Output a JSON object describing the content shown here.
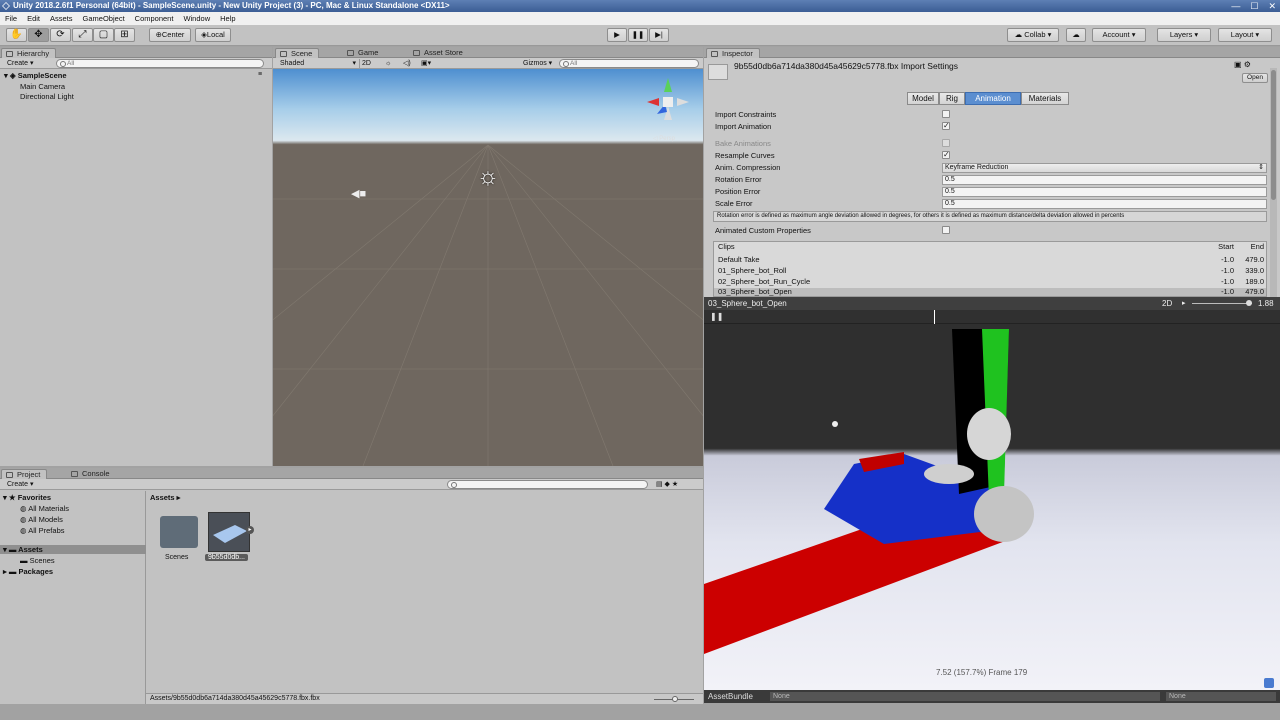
{
  "window": {
    "title": "Unity 2018.2.6f1 Personal (64bit) - SampleScene.unity - New Unity Project (3) - PC, Mac & Linux Standalone <DX11>",
    "min": "—",
    "max": "☐",
    "close": "✕"
  },
  "menu": [
    "File",
    "Edit",
    "Assets",
    "GameObject",
    "Component",
    "Window",
    "Help"
  ],
  "toolbar": {
    "center": "Center",
    "local": "Local",
    "collab": "Collab ▾",
    "account": "Account",
    "layers": "Layers",
    "layout": "Layout"
  },
  "hierarchy": {
    "tab": "Hierarchy",
    "create": "Create ▾",
    "search": "All",
    "scene": "SampleScene",
    "items": [
      "Main Camera",
      "Directional Light"
    ]
  },
  "scene": {
    "tabs": [
      "Scene",
      "Game",
      "Asset Store"
    ],
    "shaded": "Shaded",
    "twod": "2D",
    "gizmos": "Gizmos ▾",
    "search": "All",
    "persp": "◁ Persp"
  },
  "inspector": {
    "tab": "Inspector",
    "title": "9b55d0db6a714da380d45a45629c5778.fbx Import Settings",
    "open": "Open",
    "tabs": [
      "Model",
      "Rig",
      "Animation",
      "Materials"
    ],
    "active_tab": "Animation",
    "rows": [
      {
        "label": "Import Constraints",
        "type": "check",
        "checked": false
      },
      {
        "label": "Import Animation",
        "type": "check",
        "checked": true
      },
      {
        "label": "Bake Animations",
        "type": "check",
        "checked": false,
        "disabled": true
      },
      {
        "label": "Resample Curves",
        "type": "check",
        "checked": true
      },
      {
        "label": "Anim. Compression",
        "type": "select",
        "value": "Keyframe Reduction"
      },
      {
        "label": "Rotation Error",
        "type": "field",
        "value": "0.5"
      },
      {
        "label": "Position Error",
        "type": "field",
        "value": "0.5"
      },
      {
        "label": "Scale Error",
        "type": "field",
        "value": "0.5"
      }
    ],
    "help": "Rotation error is defined as maximum angle deviation allowed in degrees, for others it is defined as maximum distance/delta deviation allowed in percents",
    "custom_props": "Animated Custom Properties",
    "clips": {
      "header": "Clips",
      "start": "Start",
      "end": "End",
      "items": [
        {
          "name": "Default Take",
          "start": "-1.0",
          "end": "479.0"
        },
        {
          "name": "01_Sphere_bot_Roll",
          "start": "-1.0",
          "end": "339.0"
        },
        {
          "name": "02_Sphere_bot_Run_Cycle",
          "start": "-1.0",
          "end": "189.0"
        },
        {
          "name": "03_Sphere_bot_Open",
          "start": "-1.0",
          "end": "479.0"
        }
      ]
    }
  },
  "preview": {
    "clip": "03_Sphere_bot_Open",
    "twod": "2D",
    "speed": "1.88",
    "frame": "7.52 (157.7%) Frame 179",
    "play_progress": 0.4
  },
  "assetbundle": {
    "label": "AssetBundle",
    "name": "None",
    "variant": "None"
  },
  "project": {
    "tabs": [
      "Project",
      "Console"
    ],
    "create": "Create ▾",
    "favorites": "Favorites",
    "fav_items": [
      "All Materials",
      "All Models",
      "All Prefabs"
    ],
    "assets": "Assets",
    "asset_children": [
      "Scenes"
    ],
    "packages": "Packages",
    "breadcrumb": "Assets ▸",
    "grid": [
      {
        "name": "Scenes",
        "type": "folder"
      },
      {
        "name": "9b55d0db...",
        "type": "model",
        "selected": true
      }
    ],
    "path": "Assets/9b55d0db6a714da380d45a45629c5778.fbx.fbx"
  }
}
